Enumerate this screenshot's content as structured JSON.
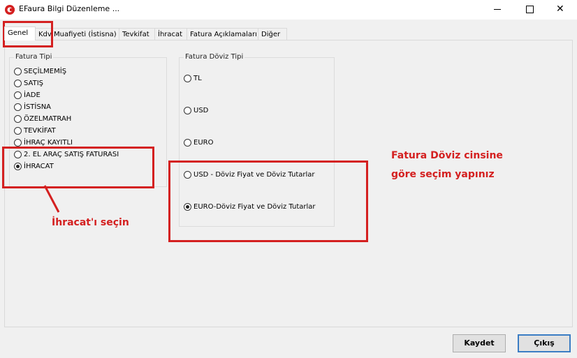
{
  "window": {
    "title": "EFaura Bilgi Düzenleme ...",
    "close_glyph": "✕"
  },
  "tabs": [
    {
      "label": "Genel"
    },
    {
      "label": "Kdv Muafiyeti (İstisna)"
    },
    {
      "label": "Tevkifat"
    },
    {
      "label": "İhracat"
    },
    {
      "label": "Fatura Açıklamaları"
    },
    {
      "label": "Diğer"
    }
  ],
  "fatura_tipi": {
    "title": "Fatura Tipi",
    "options": [
      {
        "label": "SEÇİLMEMİŞ",
        "checked": false
      },
      {
        "label": "SATIŞ",
        "checked": false
      },
      {
        "label": "İADE",
        "checked": false
      },
      {
        "label": "İSTİSNA",
        "checked": false
      },
      {
        "label": "ÖZELMATRAH",
        "checked": false
      },
      {
        "label": "TEVKİFAT",
        "checked": false
      },
      {
        "label": "İHRAÇ KAYITLI",
        "checked": false
      },
      {
        "label": "2. EL ARAÇ SATIŞ FATURASI",
        "checked": false
      },
      {
        "label": "İHRACAT",
        "checked": true
      }
    ]
  },
  "doviz_tipi": {
    "title": "Fatura Döviz Tipi",
    "options": [
      {
        "label": "TL",
        "checked": false
      },
      {
        "label": "USD",
        "checked": false
      },
      {
        "label": "EURO",
        "checked": false
      },
      {
        "label": "USD - Döviz Fiyat ve Döviz Tutarlar",
        "checked": false
      },
      {
        "label": "EURO-Döviz Fiyat ve Döviz Tutarlar",
        "checked": true
      }
    ]
  },
  "annotations": {
    "ihracat_note": "İhracat'ı seçin",
    "doviz_note_line1": "Fatura Döviz cinsine",
    "doviz_note_line2": "göre seçim yapınız"
  },
  "buttons": {
    "save": "Kaydet",
    "exit": "Çıkış"
  },
  "colors": {
    "annotation_red": "#d42020",
    "default_button_border": "#3b7dc4"
  }
}
